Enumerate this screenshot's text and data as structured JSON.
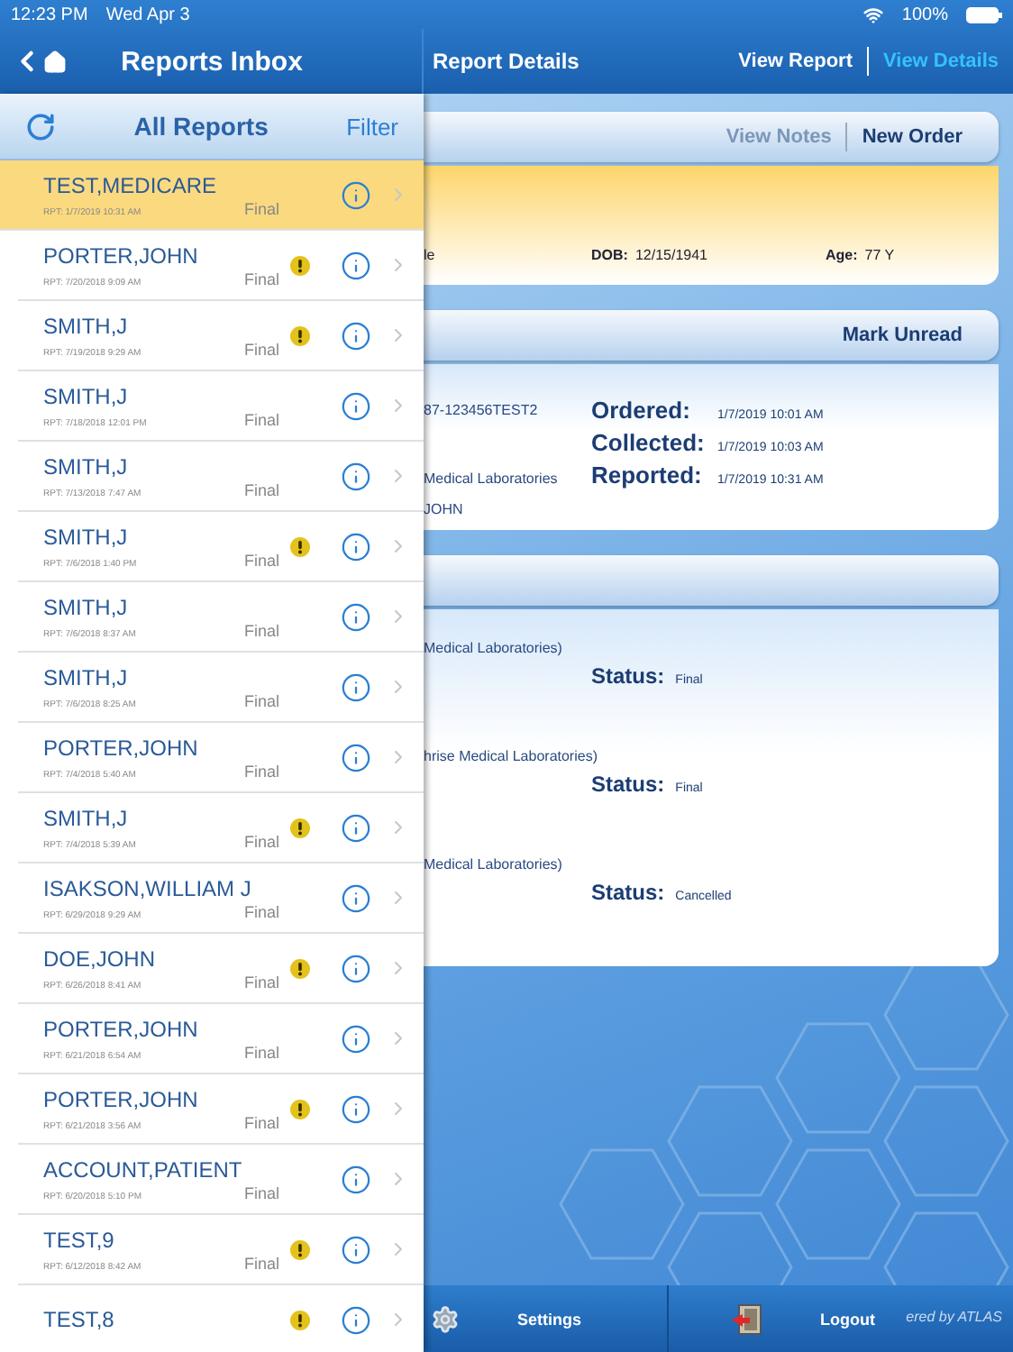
{
  "status_bar": {
    "time": "12:23 PM",
    "date": "Wed Apr 3",
    "battery": "100%"
  },
  "inbox": {
    "title": "Reports Inbox",
    "list_title": "All Reports",
    "filter": "Filter",
    "reports": [
      {
        "name": "TEST,MEDICARE",
        "date": "RPT: 1/7/2019 10:31 AM",
        "status": "Final",
        "flagged": false,
        "selected": true
      },
      {
        "name": "PORTER,JOHN",
        "date": "RPT: 7/20/2018 9:09 AM",
        "status": "Final",
        "flagged": true,
        "selected": false
      },
      {
        "name": "SMITH,J",
        "date": "RPT: 7/19/2018 9:29 AM",
        "status": "Final",
        "flagged": true,
        "selected": false
      },
      {
        "name": "SMITH,J",
        "date": "RPT: 7/18/2018 12:01 PM",
        "status": "Final",
        "flagged": false,
        "selected": false
      },
      {
        "name": "SMITH,J",
        "date": "RPT: 7/13/2018 7:47 AM",
        "status": "Final",
        "flagged": false,
        "selected": false
      },
      {
        "name": "SMITH,J",
        "date": "RPT: 7/6/2018 1:40 PM",
        "status": "Final",
        "flagged": true,
        "selected": false
      },
      {
        "name": "SMITH,J",
        "date": "RPT: 7/6/2018 8:37 AM",
        "status": "Final",
        "flagged": false,
        "selected": false
      },
      {
        "name": "SMITH,J",
        "date": "RPT: 7/6/2018 8:25 AM",
        "status": "Final",
        "flagged": false,
        "selected": false
      },
      {
        "name": "PORTER,JOHN",
        "date": "RPT: 7/4/2018 5:40 AM",
        "status": "Final",
        "flagged": false,
        "selected": false
      },
      {
        "name": "SMITH,J",
        "date": "RPT: 7/4/2018 5:39 AM",
        "status": "Final",
        "flagged": true,
        "selected": false
      },
      {
        "name": "ISAKSON,WILLIAM J",
        "date": "RPT: 6/29/2018 9:29 AM",
        "status": "Final",
        "flagged": false,
        "selected": false
      },
      {
        "name": "DOE,JOHN",
        "date": "RPT: 6/26/2018 8:41 AM",
        "status": "Final",
        "flagged": true,
        "selected": false
      },
      {
        "name": "PORTER,JOHN",
        "date": "RPT: 6/21/2018 6:54 AM",
        "status": "Final",
        "flagged": false,
        "selected": false
      },
      {
        "name": "PORTER,JOHN",
        "date": "RPT: 6/21/2018 3:56 AM",
        "status": "Final",
        "flagged": true,
        "selected": false
      },
      {
        "name": "ACCOUNT,PATIENT",
        "date": "RPT: 6/20/2018 5:10 PM",
        "status": "Final",
        "flagged": false,
        "selected": false
      },
      {
        "name": "TEST,9",
        "date": "RPT: 6/12/2018 8:42 AM",
        "status": "Final",
        "flagged": true,
        "selected": false
      },
      {
        "name": "TEST,8",
        "flagged": true,
        "selected": false
      }
    ]
  },
  "details": {
    "title": "Report Details",
    "tabs": [
      {
        "label": "View Report",
        "selected": false
      },
      {
        "label": "View Details",
        "selected": true
      }
    ],
    "actions": [
      {
        "label": "View Notes",
        "disabled": true
      },
      {
        "label": "New Order",
        "disabled": false
      }
    ],
    "patient": {
      "name_fragment": "le",
      "dob_label": "DOB:",
      "dob": "12/15/1941",
      "age_label": "Age:",
      "age": "77 Y"
    },
    "order": {
      "action": "Mark Unread",
      "lines": [
        "87-123456TEST2",
        "Medical Laboratories",
        "JOHN"
      ],
      "times": [
        {
          "label": "Ordered:",
          "date": "1/7/2019",
          "time": "10:01 AM"
        },
        {
          "label": "Collected:",
          "date": "1/7/2019",
          "time": "10:03 AM"
        },
        {
          "label": "Reported:",
          "date": "1/7/2019",
          "time": "10:31 AM"
        }
      ]
    },
    "tests": [
      {
        "lab": "Medical Laboratories)",
        "status_label": "Status:",
        "status": "Final"
      },
      {
        "lab": "hrise Medical Laboratories)",
        "status_label": "Status:",
        "status": "Final"
      },
      {
        "lab": "Medical Laboratories)",
        "status_label": "Status:",
        "status": "Cancelled"
      }
    ]
  },
  "toolbar": [
    {
      "label": "Settings",
      "kind": "settings"
    },
    {
      "label": "Logout",
      "kind": "logout"
    }
  ],
  "footer_brand": "ered by ATLAS"
}
